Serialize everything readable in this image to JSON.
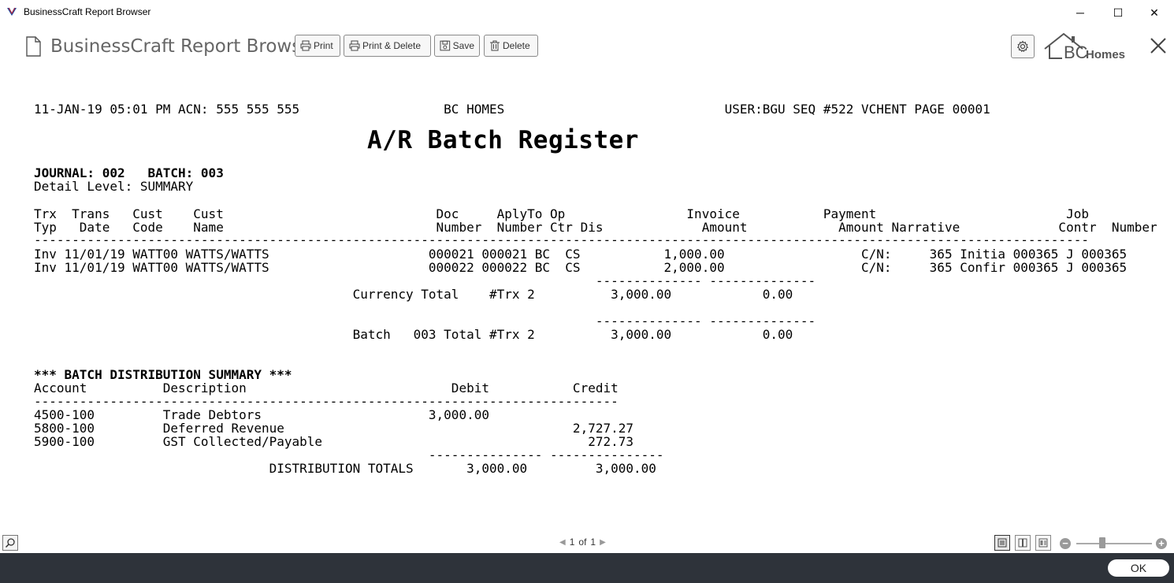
{
  "window": {
    "title": "BusinessCraft Report Browser",
    "minimize_glyph": "─",
    "maximize_glyph": "☐",
    "close_glyph": "✕"
  },
  "toolbar": {
    "app_title": "BusinessCraft Report Browser",
    "print_label": "Print",
    "print_delete_label": "Print & Delete",
    "save_label": "Save",
    "delete_label": "Delete",
    "brand_bc": "BC",
    "brand_homes": "Homes"
  },
  "report": {
    "header_line": "11-JAN-19 05:01 PM ACN: 555 555 555                   BC HOMES                             USER:BGU SEQ #522 VCHENT PAGE 00001",
    "title": "A/R Batch Register",
    "journal_line": "JOURNAL: 002   BATCH: 003",
    "detail_level": "Detail Level: SUMMARY",
    "col_header_1": "Trx  Trans   Cust    Cust                            Doc     AplyTo Op                Invoice           Payment                         Job",
    "col_header_2": "Typ   Date   Code    Name                            Number  Number Ctr Dis             Amount            Amount Narrative             Contr  Number",
    "separator_main": "-------------------------------------------------------------------------------------------------------------------------------------------",
    "rows": [
      "Inv 11/01/19 WATT00 WATTS/WATTS                     000021 000021 BC  CS           1,000.00                  C/N:     365 Initia 000365 J 000365",
      "Inv 11/01/19 WATT00 WATTS/WATTS                     000022 000022 BC  CS           2,000.00                  C/N:     365 Confir 000365 J 000365"
    ],
    "subtotal_rule": "                                                                          -------------- --------------",
    "currency_total": "                                          Currency Total    #Trx 2          3,000.00            0.00",
    "batch_total": "                                          Batch   003 Total #Trx 2          3,000.00            0.00",
    "dist_title": "*** BATCH DISTRIBUTION SUMMARY ***",
    "dist_header": "Account          Description                           Debit           Credit",
    "dist_separator": "-----------------------------------------------------------------------------",
    "dist_rows": [
      "4500-100         Trade Debtors                      3,000.00",
      "5800-100         Deferred Revenue                                      2,727.27",
      "5900-100         GST Collected/Payable                                   272.73"
    ],
    "dist_rule": "                                                    --------------- ---------------",
    "dist_totals": "                               DISTRIBUTION TOTALS       3,000.00         3,000.00"
  },
  "pager": {
    "current": "1",
    "of": "of",
    "total": "1"
  },
  "zoom": {
    "level": 0.33
  },
  "footer": {
    "ok_label": "OK"
  }
}
